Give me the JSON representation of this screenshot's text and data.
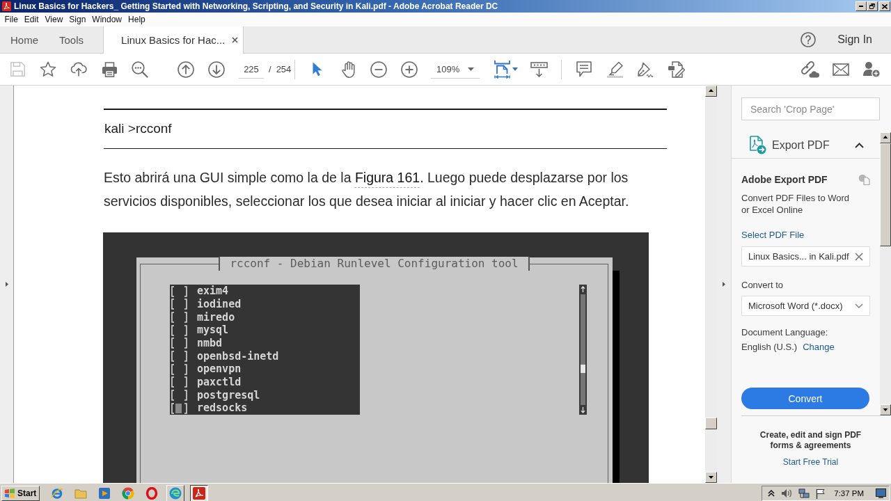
{
  "window": {
    "title": "Linux Basics for Hackers_ Getting Started with Networking, Scripting, and Security in Kali.pdf - Adobe Acrobat Reader DC"
  },
  "menu": [
    "File",
    "Edit",
    "View",
    "Sign",
    "Window",
    "Help"
  ],
  "tabs": [
    {
      "label": "Home",
      "selected": false,
      "closable": false
    },
    {
      "label": "Tools",
      "selected": false,
      "closable": false
    },
    {
      "label": "Linux Basics for Hac...",
      "selected": true,
      "closable": true
    }
  ],
  "account": {
    "sign_in": "Sign In"
  },
  "toolbar": {
    "save": {
      "disabled": true
    },
    "page": "225",
    "page_separator": "/",
    "page_count": "254",
    "tools": [
      {
        "kind": "select",
        "selected": true
      },
      {
        "kind": "hand",
        "selected": false
      }
    ],
    "zoom": "109%"
  },
  "document": {
    "command": "kali >rcconf",
    "paragraph": {
      "before": "Esto abrirá una GUI simple como la de la ",
      "link": "Figura 161",
      "after": ". Luego puede desplazarse por los servicios disponibles, seleccionar los que desea iniciar al iniciar y hacer clic en Aceptar."
    },
    "figure": {
      "title": "rcconf - Debian Runlevel Configuration tool",
      "services": [
        {
          "label": "exim4",
          "checked": false,
          "selected": false
        },
        {
          "label": "iodined",
          "checked": false,
          "selected": false
        },
        {
          "label": "miredo",
          "checked": false,
          "selected": false
        },
        {
          "label": "mysql",
          "checked": false,
          "selected": false
        },
        {
          "label": "nmbd",
          "checked": false,
          "selected": false
        },
        {
          "label": "openbsd-inetd",
          "checked": false,
          "selected": false
        },
        {
          "label": "openvpn",
          "checked": false,
          "selected": false
        },
        {
          "label": "paxctld",
          "checked": false,
          "selected": false
        },
        {
          "label": "postgresql",
          "checked": false,
          "selected": false
        },
        {
          "label": "redsocks",
          "checked": false,
          "selected": true
        }
      ]
    }
  },
  "panel": {
    "search": {
      "placeholder": "Search 'Crop Page'"
    },
    "section": {
      "title": "Export PDF",
      "expanded": true
    },
    "heading": "Adobe Export PDF",
    "description": "Convert PDF Files to Word or Excel Online",
    "select_file": "Select PDF File",
    "file": "Linux Basics... in Kali.pdf",
    "convert_to_label": "Convert to",
    "format": "Microsoft Word (*.docx)",
    "language_label": "Document Language:",
    "language": "English (U.S.)",
    "change": "Change",
    "convert_button": "Convert",
    "promo": "Create, edit and sign PDF forms & agreements",
    "trial": "Start Free Trial"
  },
  "taskbar": {
    "start": "Start",
    "apps": [
      {
        "kind": "ie",
        "running": false,
        "selected": false
      },
      {
        "kind": "folder",
        "running": false,
        "selected": false
      },
      {
        "kind": "media",
        "running": false,
        "selected": false
      },
      {
        "kind": "chrome",
        "running": false,
        "selected": false
      },
      {
        "kind": "opera",
        "running": false,
        "selected": false
      },
      {
        "kind": "edge",
        "running": true,
        "selected": false
      },
      {
        "kind": "acrobat",
        "running": true,
        "selected": true
      }
    ],
    "clock": "7:37 PM"
  }
}
